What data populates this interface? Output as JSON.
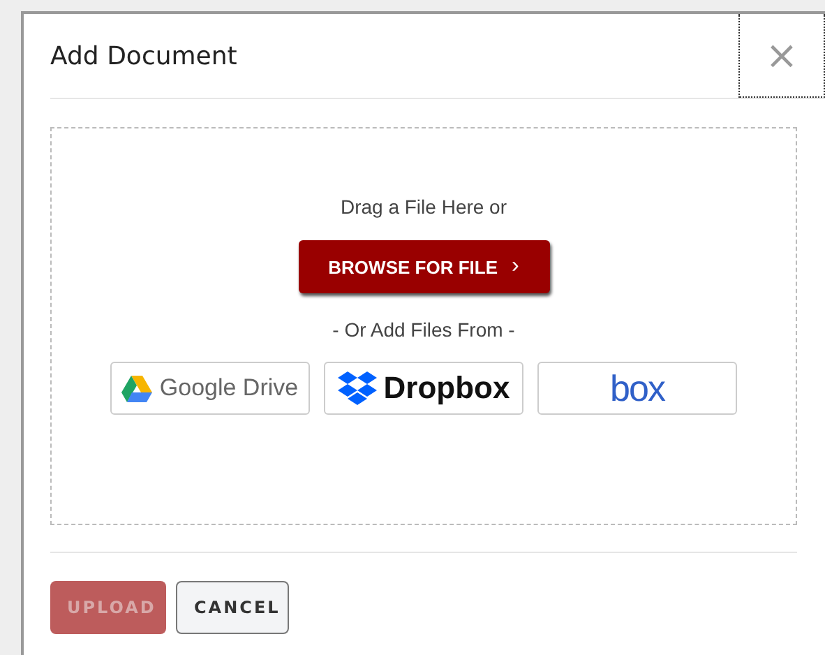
{
  "dialog": {
    "title": "Add Document",
    "close": "×"
  },
  "dropzone": {
    "prompt": "Drag a File Here or",
    "browse": "BROWSE FOR FILE",
    "chevron": "›",
    "alt": "- Or Add Files From -"
  },
  "sources": [
    {
      "kind": "gdrive",
      "label": "Google Drive"
    },
    {
      "kind": "dropbox",
      "label": "Dropbox"
    },
    {
      "kind": "box",
      "label": "box"
    }
  ],
  "buttons": [
    {
      "label": "UPLOAD",
      "kind": "primary",
      "disabled": true
    },
    {
      "label": "CANCEL",
      "kind": "secondary",
      "disabled": false
    }
  ]
}
